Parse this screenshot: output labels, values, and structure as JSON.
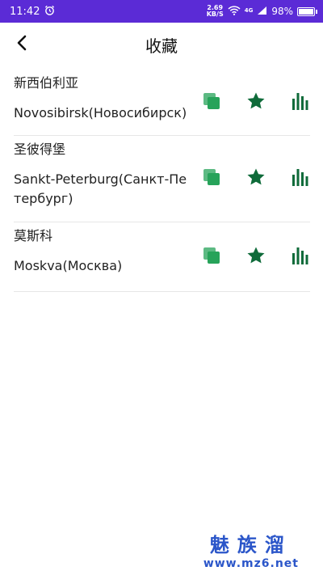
{
  "status_bar": {
    "time": "11:42",
    "net_speed_value": "2.69",
    "net_speed_unit": "KB/S",
    "network": "4G",
    "battery": "98%",
    "battery_level": 0.98,
    "icons": [
      "alarm-icon",
      "wifi-icon",
      "signal-icon",
      "battery-icon"
    ]
  },
  "app_bar": {
    "title": "收藏",
    "back_icon": "chevron-left-icon"
  },
  "favorites": [
    {
      "name_zh": "新西伯利亚",
      "name_en": "Novosibirsk(Новосибирск)"
    },
    {
      "name_zh": "圣彼得堡",
      "name_en": "Sankt-Peterburg(Санкт-Петербург)"
    },
    {
      "name_zh": "莫斯科",
      "name_en": "Moskva(Москва)"
    }
  ],
  "colors": {
    "status_bar": "#5b2bd6",
    "copy_icon": "#27a35a",
    "star_icon": "#0f6b3a",
    "chart_icon": "#0f6b3a",
    "watermark": "#2b56c9"
  },
  "watermark": {
    "brand": "魅族溜",
    "url": "www.mz6.net"
  }
}
